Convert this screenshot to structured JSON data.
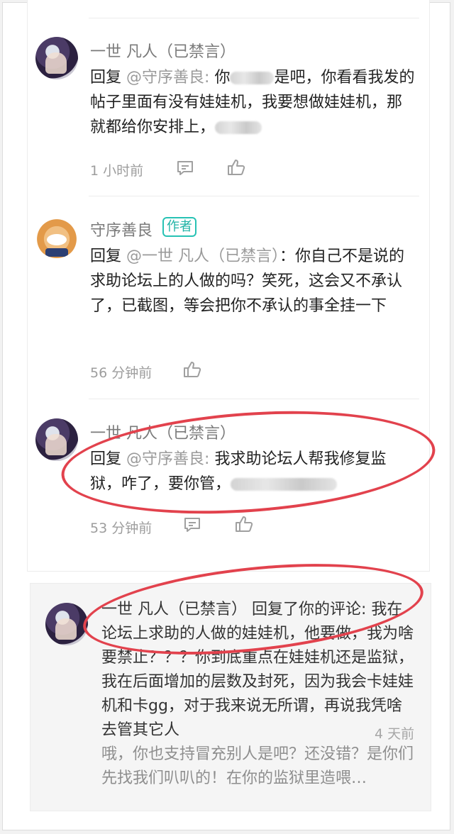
{
  "comments": [
    {
      "name": "一世 凡人（已禁言）",
      "reply_prefix": "回复",
      "mention": "@守序善良",
      "colon": ": ",
      "text_a": "你",
      "text_b": "是吧，你看看我发的帖子里面有没有娃娃机，我要想做娃娃机，那就都给你安排上，",
      "time": "1 小时前"
    },
    {
      "name": "守序善良",
      "badge": "作者",
      "reply_prefix": "回复",
      "mention": "@一世 凡人（已禁言）",
      "colon": "：",
      "text": "你自己不是说的求助论坛上的人做的吗？笑死，这会又不承认了，已截图，等会把你不承认的事全挂一下",
      "time": "56 分钟前"
    },
    {
      "name": "一世 凡人（已禁言）",
      "reply_prefix": "回复",
      "mention": "@守序善良",
      "colon": ": ",
      "text": "我求助论坛人帮我修复监狱，咋了，要你管，",
      "time": "53 分钟前"
    }
  ],
  "notification": {
    "name": "一世 凡人（已禁言）",
    "action": " 回复了你的评论: ",
    "text": "我在论坛上求助的人做的娃娃机，他要做，我为啥要禁止？？？你到底重点在娃娃机还是监狱，我在后面增加的层数及封死，因为我会卡娃娃机和卡gg，对于我来说无所谓，再说我凭啥去管其它人",
    "quote": "哦，你也支持冒充别人是吧？还没错？是你们先找我们叭叭的！在你的监狱里造喂…",
    "time": "4 天前"
  },
  "colors": {
    "accent_teal": "#27c2b4",
    "circle_red": "#e2424d"
  },
  "icons": [
    "reply-icon",
    "like-icon"
  ]
}
